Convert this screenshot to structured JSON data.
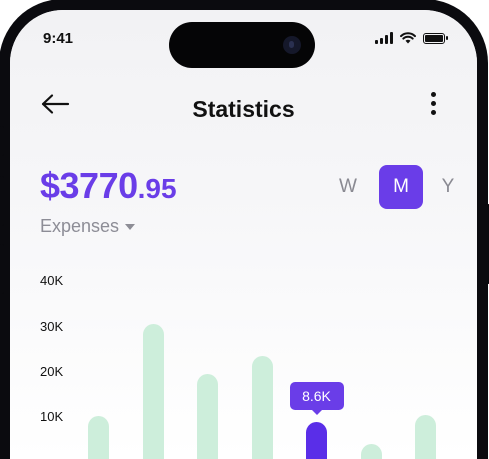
{
  "status_bar": {
    "time": "9:41"
  },
  "header": {
    "title": "Statistics",
    "back_icon": "arrow-left-icon",
    "more_icon": "more-vertical-icon"
  },
  "summary": {
    "amount_main": "$3770",
    "amount_cents": ".95",
    "category": "Expenses"
  },
  "periods": [
    {
      "label": "W",
      "active": false
    },
    {
      "label": "M",
      "active": true
    },
    {
      "label": "Y",
      "active": false
    }
  ],
  "colors": {
    "accent": "#6a3de8",
    "bar": "#cdeedb",
    "bar_active": "#5a2ee8"
  },
  "chart_data": {
    "type": "bar",
    "y_ticks": [
      "40K",
      "30K",
      "20K",
      "10K"
    ],
    "ylim": [
      0,
      40
    ],
    "values": [
      10,
      30.5,
      19.5,
      23.5,
      8.6,
      3.7,
      10.3
    ],
    "highlight_index": 4,
    "tooltip": "8.6K"
  }
}
